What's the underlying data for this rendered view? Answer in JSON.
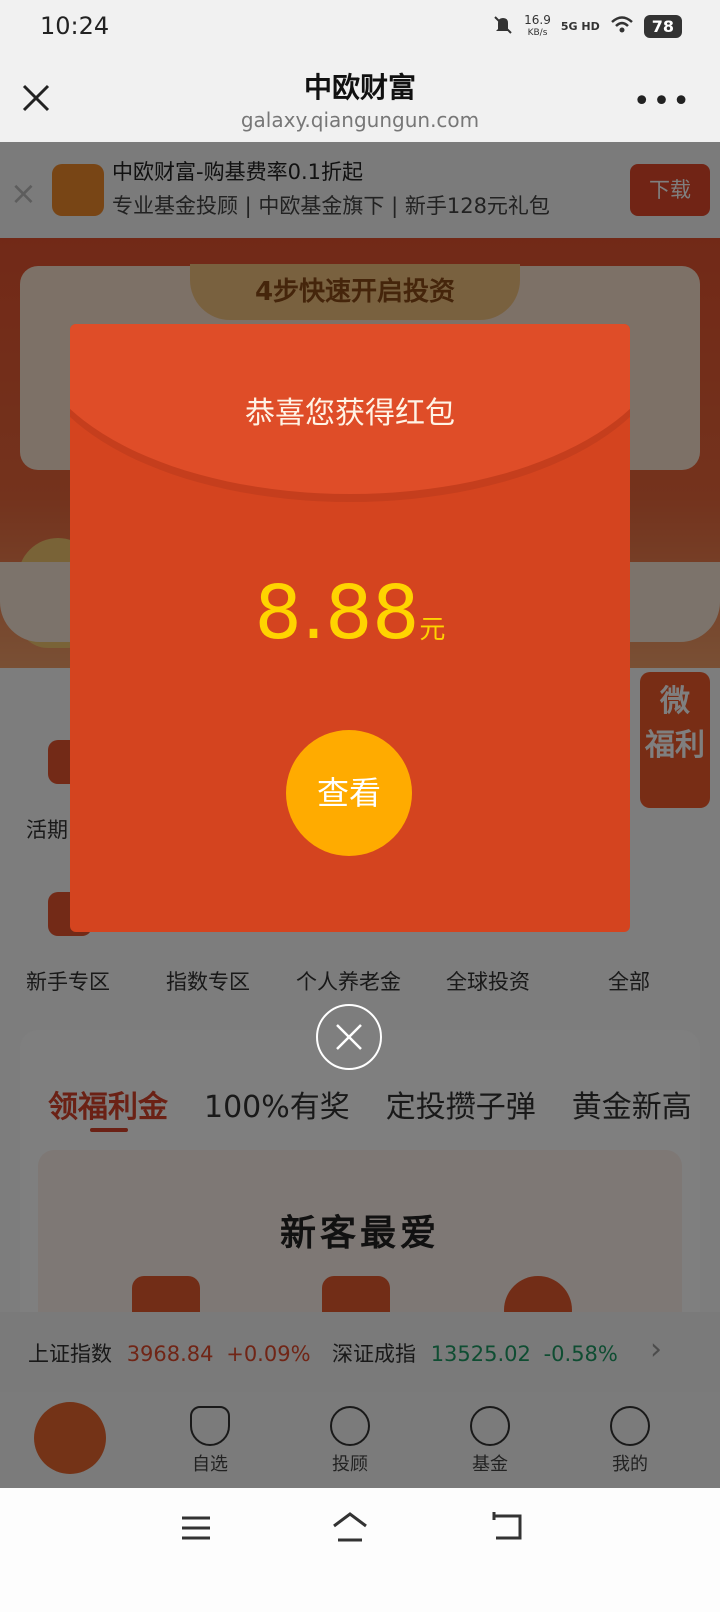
{
  "status_bar": {
    "time": "10:24",
    "net_speed": "16.9",
    "net_unit": "KB/s",
    "net_type": "5G HD",
    "battery": "78"
  },
  "nav": {
    "title": "中欧财富",
    "url": "galaxy.qiangungun.com",
    "close_icon": "close-icon",
    "more_label": "•••"
  },
  "banner": {
    "close": "×",
    "line1": "中欧财富-购基费率0.1折起",
    "line2": "专业基金投顾 | 中欧基金旗下 | 新手128元礼包",
    "download": "下载"
  },
  "hero": {
    "tab_title": "4步快速开启投资"
  },
  "quick_access": {
    "row1_first": "活期",
    "row2": [
      "新手专区",
      "指数专区",
      "个人养老金",
      "全球投资",
      "全部"
    ],
    "side_badge": "微\n福利"
  },
  "tabs": [
    "领福利金",
    "100%有奖",
    "定投攒子弹",
    "黄金新高"
  ],
  "promo": {
    "title": "新客最爱"
  },
  "ticker": {
    "items": [
      {
        "name": "上证指数",
        "value": "3968.84",
        "change": "+0.09%"
      },
      {
        "name": "深证成指",
        "value": "13525.02",
        "change": "-0.58%"
      }
    ],
    "arrow": "›"
  },
  "tabbar": {
    "items": [
      "自选",
      "投顾",
      "基金",
      "我的"
    ]
  },
  "red_packet": {
    "title": "恭喜您获得红包",
    "amount": "8.88",
    "unit": "元",
    "button": "查看"
  },
  "colors": {
    "accent_red": "#d4441f",
    "gold": "#ffd400",
    "button_orange": "#ffab00",
    "up_red": "#e04a2c",
    "down_green": "#1f9a65"
  }
}
